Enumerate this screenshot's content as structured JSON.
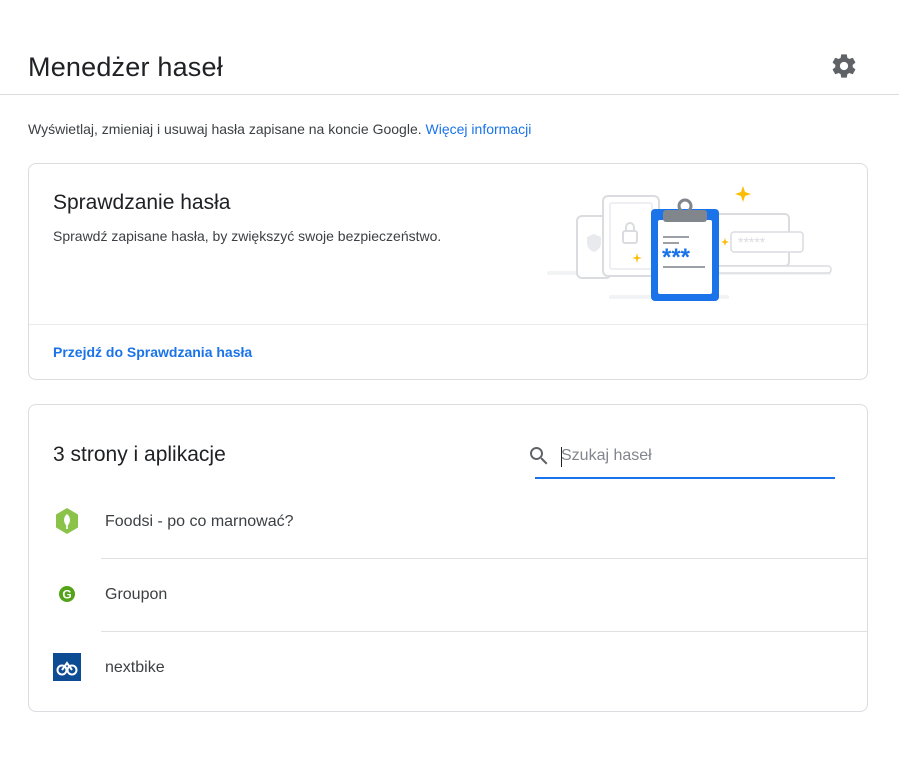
{
  "header": {
    "title": "Menedżer haseł",
    "settings_icon": "gear-icon"
  },
  "intro": {
    "text": "Wyświetlaj, zmieniaj i usuwaj hasła zapisane na koncie Google.",
    "link": "Więcej informacji"
  },
  "password_check": {
    "title": "Sprawdzanie hasła",
    "description": "Sprawdź zapisane hasła, by zwiększyć swoje bezpieczeństwo.",
    "link": "Przejdź do Sprawdzania hasła",
    "illustration": "password-check-clipboard-illustration",
    "masked_password": "***"
  },
  "passwords": {
    "title": "3 strony i aplikacje",
    "search_placeholder": "Szukaj haseł",
    "search_icon": "search-icon",
    "items": [
      {
        "name": "Foodsi - po co marnować?",
        "icon": "foodsi-icon",
        "color": "#8bc34a"
      },
      {
        "name": "Groupon",
        "icon": "groupon-icon",
        "color": "#53a318"
      },
      {
        "name": "nextbike",
        "icon": "nextbike-icon",
        "color": "#0d4c92"
      }
    ]
  },
  "colors": {
    "accent": "#1a73e8",
    "clipboard": "#1a73e8",
    "sparkle": "#fbbc04"
  }
}
